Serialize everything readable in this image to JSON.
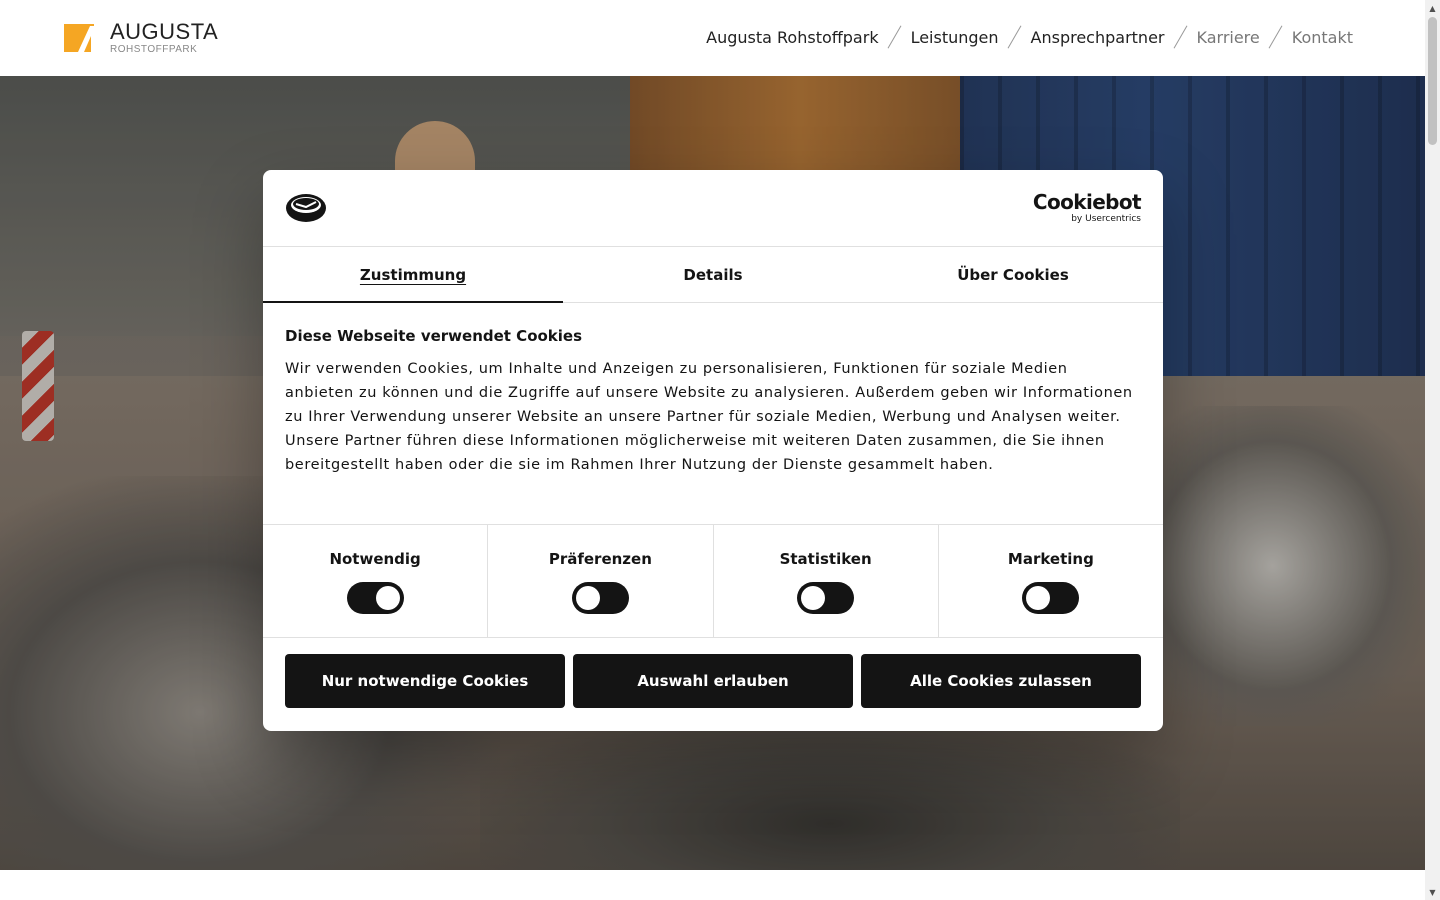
{
  "header": {
    "logo": {
      "main": "AUGUSTA",
      "sub": "ROHSTOFFPARK",
      "accent": "#f5a623"
    },
    "nav": [
      {
        "label": "Augusta Rohstoffpark",
        "muted": false
      },
      {
        "label": "Leistungen",
        "muted": false
      },
      {
        "label": "Ansprechpartner",
        "muted": false
      },
      {
        "label": "Karriere",
        "muted": true
      },
      {
        "label": "Kontakt",
        "muted": true
      }
    ]
  },
  "cookie_dialog": {
    "brand": {
      "main": "Cookiebot",
      "sub": "by Usercentrics"
    },
    "tabs": [
      {
        "label": "Zustimmung",
        "active": true
      },
      {
        "label": "Details",
        "active": false
      },
      {
        "label": "Über Cookies",
        "active": false
      }
    ],
    "title": "Diese Webseite verwendet Cookies",
    "text": "Wir verwenden Cookies, um Inhalte und Anzeigen zu personalisieren, Funktionen für soziale Medien anbieten zu können und die Zugriffe auf unsere Website zu analysieren. Außerdem geben wir Informationen zu Ihrer Verwendung unserer Website an unsere Partner für soziale Medien, Werbung und Analysen weiter. Unsere Partner führen diese Informationen möglicherweise mit weiteren Daten zusammen, die Sie ihnen bereitgestellt haben oder die sie im Rahmen Ihrer Nutzung der Dienste gesammelt haben.",
    "toggles": [
      {
        "label": "Notwendig",
        "on": true
      },
      {
        "label": "Präferenzen",
        "on": false
      },
      {
        "label": "Statistiken",
        "on": false
      },
      {
        "label": "Marketing",
        "on": false
      }
    ],
    "buttons": {
      "necessary": "Nur notwendige Cookies",
      "selection": "Auswahl erlauben",
      "all": "Alle Cookies zulassen"
    }
  },
  "colors": {
    "dark": "#141414",
    "divider": "#e0e0e0"
  }
}
